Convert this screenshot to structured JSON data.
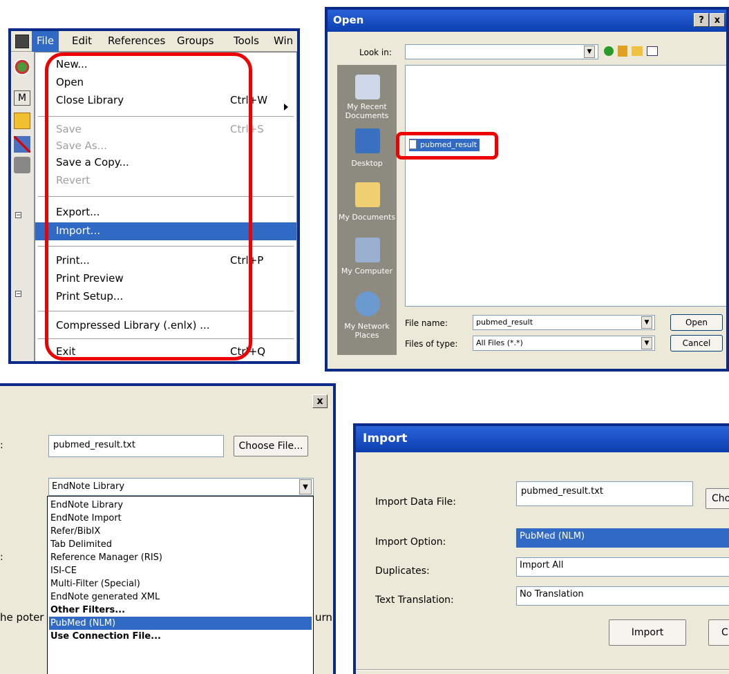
{
  "file_menu": {
    "menubar": [
      "File",
      "Edit",
      "References",
      "Groups",
      "Tools",
      "Win"
    ],
    "items": {
      "new": "New...",
      "open": "Open",
      "close_library": "Close Library",
      "save": "Save",
      "save_as": "Save As...",
      "save_copy": "Save a Copy...",
      "revert": "Revert",
      "export": "Export...",
      "import": "Import...",
      "print": "Print...",
      "print_preview": "Print Preview",
      "print_setup": "Print Setup...",
      "compressed": "Compressed Library (.enlx) ...",
      "exit": "Exit"
    },
    "shortcuts": {
      "close_library": "Ctrl+W",
      "save": "Ctrl+S",
      "print": "Ctrl+P",
      "exit": "Ctrl+Q"
    },
    "side_letter": "M",
    "highlight_color": "#316ac5",
    "annotation_color": "#e00000"
  },
  "open_dialog": {
    "title": "Open",
    "help_btn": "?",
    "close_btn": "x",
    "look_in_label": "Look in:",
    "places": [
      "My Recent Documents",
      "Desktop",
      "My Documents",
      "My Computer",
      "My Network Places"
    ],
    "file_item": "pubmed_result",
    "file_name_label": "File name:",
    "file_name_value": "pubmed_result",
    "files_of_type_label": "Files of type:",
    "files_of_type_value": "All Files (*.*)",
    "open_btn": "Open",
    "cancel_btn": "Cancel"
  },
  "import_dropdown_dialog": {
    "close_btn": "x",
    "label_colon_1": ":",
    "label_colon_2": ":",
    "file_value": "pubmed_result.txt",
    "choose_btn": "Choose File...",
    "option_value": "EndNote Library",
    "options": [
      "EndNote Library",
      "EndNote Import",
      "Refer/BibIX",
      "Tab Delimited",
      "Reference Manager (RIS)",
      "ISI-CE",
      "Multi-Filter (Special)",
      "EndNote generated XML",
      "Other Filters...",
      "PubMed (NLM)",
      "Use Connection File..."
    ],
    "bg_text_left": "he poter",
    "bg_text_right": "urn"
  },
  "import_dialog": {
    "title": "Import",
    "data_file_label": "Import Data File:",
    "data_file_value": "pubmed_result.txt",
    "choose_btn": "Choos",
    "option_label": "Import Option:",
    "option_value": "PubMed (NLM)",
    "duplicates_label": "Duplicates:",
    "duplicates_value": "Import All",
    "translation_label": "Text Translation:",
    "translation_value": "No Translation",
    "import_btn": "Import",
    "cancel_partial": "C"
  }
}
